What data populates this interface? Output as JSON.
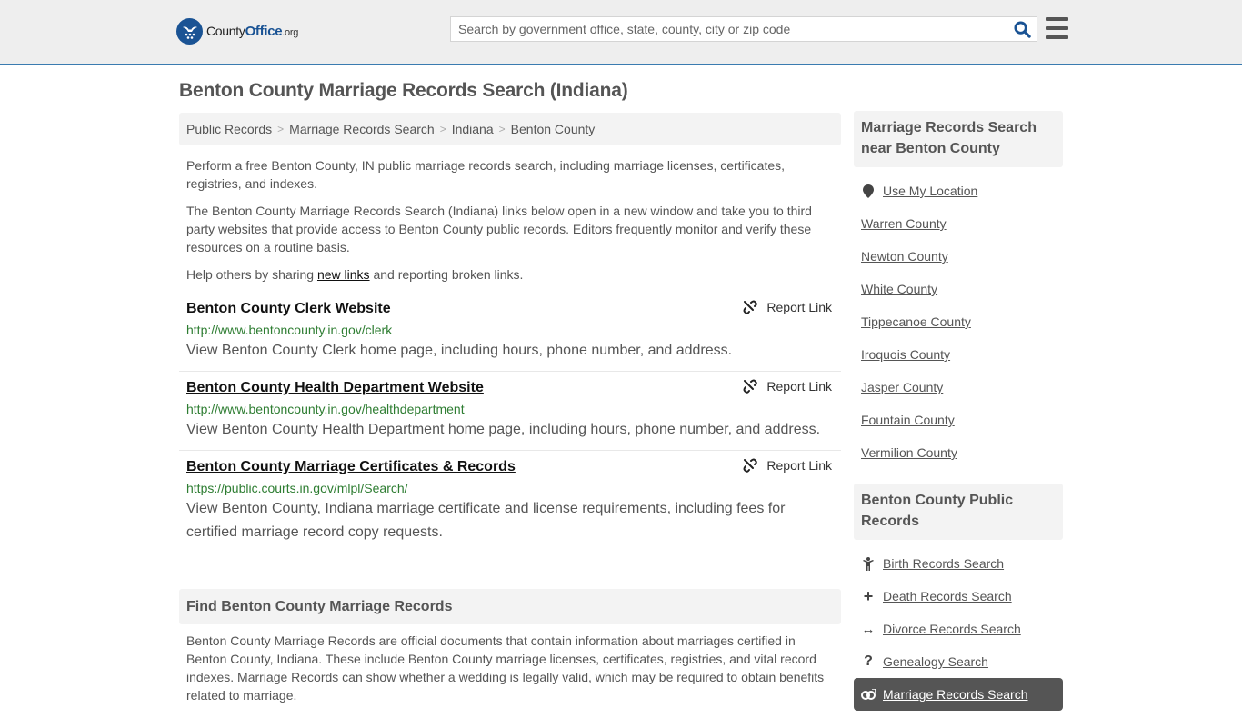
{
  "header": {
    "logo": {
      "name_part1": "County",
      "name_part2": "Office",
      "name_part3": ".org"
    },
    "search": {
      "placeholder": "Search by government office, state, county, city or zip code",
      "value": ""
    },
    "colors": {
      "brand": "#1a5394",
      "accent_border": "#3a7bb0",
      "header_bg": "#eeeeee"
    }
  },
  "page": {
    "title": "Benton County Marriage Records Search (Indiana)"
  },
  "breadcrumb": [
    {
      "label": "Public Records"
    },
    {
      "label": "Marriage Records Search"
    },
    {
      "label": "Indiana"
    },
    {
      "label": "Benton County"
    }
  ],
  "intro": {
    "p1": "Perform a free Benton County, IN public marriage records search, including marriage licenses, certificates, registries, and indexes.",
    "p2": "The Benton County Marriage Records Search (Indiana) links below open in a new window and take you to third party websites that provide access to Benton County public records. Editors frequently monitor and verify these resources on a routine basis.",
    "p3_before": "Help others by sharing ",
    "p3_link": "new links",
    "p3_after": " and reporting broken links."
  },
  "results": [
    {
      "title": "Benton County Clerk Website",
      "url": "http://www.bentoncounty.in.gov/clerk",
      "description": "View Benton County Clerk home page, including hours, phone number, and address.",
      "report_label": "Report Link"
    },
    {
      "title": "Benton County Health Department Website",
      "url": "http://www.bentoncounty.in.gov/healthdepartment",
      "description": "View Benton County Health Department home page, including hours, phone number, and address.",
      "report_label": "Report Link"
    },
    {
      "title": "Benton County Marriage Certificates & Records",
      "url": "https://public.courts.in.gov/mlpl/Search/",
      "description": "View Benton County, Indiana marriage certificate and license requirements, including fees for certified marriage record copy requests.",
      "report_label": "Report Link"
    }
  ],
  "find_section": {
    "heading": "Find Benton County Marriage Records",
    "body": "Benton County Marriage Records are official documents that contain information about marriages certified in Benton County, Indiana. These include Benton County marriage licenses, certificates, registries, and vital record indexes. Marriage Records can show whether a wedding is legally valid, which may be required to obtain benefits related to marriage."
  },
  "sidebar": {
    "nearby": {
      "heading": "Marriage Records Search near Benton County",
      "use_location": {
        "label": "Use My Location",
        "icon": "map-marker-icon"
      },
      "counties": [
        "Warren County",
        "Newton County",
        "White County",
        "Tippecanoe County",
        "Iroquois County",
        "Jasper County",
        "Fountain County",
        "Vermilion County"
      ]
    },
    "public_records": {
      "heading": "Benton County Public Records",
      "items": [
        {
          "label": "Birth Records Search",
          "icon": "child-icon"
        },
        {
          "label": "Death Records Search",
          "icon": "cross-icon",
          "glyph": "+"
        },
        {
          "label": "Divorce Records Search",
          "icon": "arrows-horizontal-icon",
          "glyph": "↔"
        },
        {
          "label": "Genealogy Search",
          "icon": "question-icon",
          "glyph": "?"
        },
        {
          "label": "Marriage Records Search",
          "icon": "rings-icon",
          "active": true
        }
      ]
    }
  }
}
